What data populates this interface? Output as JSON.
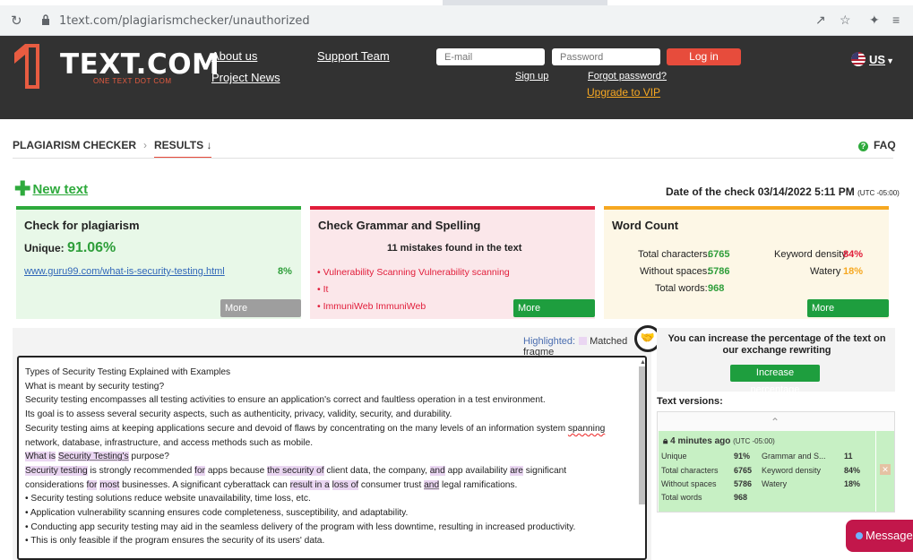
{
  "browser": {
    "url": "1text.com/plagiarismchecker/unauthorized",
    "icons": [
      "reload-icon",
      "lock-icon",
      "share-icon",
      "star-icon",
      "extensions-icon",
      "reading-list-icon"
    ]
  },
  "header": {
    "logo_text": "TEXT.COM",
    "logo_sub": "ONE TEXT DOT COM",
    "nav": {
      "about": "About us",
      "news": "Project News",
      "support": "Support Team"
    },
    "email_placeholder": "E-mail",
    "password_placeholder": "Password",
    "login_label": "Log in",
    "signup_label": "Sign up",
    "forgot_label": "Forgot password?",
    "vip_label": "Upgrade to VIP",
    "lang_label": "US"
  },
  "breadcrumbs": {
    "root": "PLAGIARISM CHECKER",
    "current": "RESULTS",
    "current_arrow": "↓",
    "faq": "FAQ"
  },
  "new_text_label": "New text",
  "date_check": {
    "label": "Date of the check 03/14/2022 5:11 PM",
    "tz": "(UTC -05:00)"
  },
  "cards": {
    "plagiarism": {
      "title": "Check for plagiarism",
      "unique_label": "Unique:",
      "unique_value": "91.06%",
      "source_url": "www.guru99.com/what-is-security-testing.html",
      "source_percent": "8%",
      "more": "More information"
    },
    "grammar": {
      "title": "Check Grammar and Spelling",
      "summary": "11 mistakes found in the text",
      "items": [
        "• Vulnerability Scanning Vulnerability scanning",
        "• It",
        "• ImmuniWeb ImmuniWeb"
      ],
      "more": "More information"
    },
    "wordcount": {
      "title": "Word Count",
      "total_chars_label": "Total characters:",
      "total_chars": "6765",
      "without_spaces_label": "Without spaces:",
      "without_spaces": "5786",
      "total_words_label": "Total words:",
      "total_words": "968",
      "keyword_density_label": "Keyword density",
      "keyword_density": "84%",
      "watery_label": "Watery",
      "watery": "18%",
      "more": "More information"
    }
  },
  "editor": {
    "highlighted_label": "Highlighted:",
    "matched_label": "Matched fragme",
    "lines": {
      "l1": "Types of Security Testing Explained with Examples",
      "l2": "What is meant by security testing?",
      "l3": "Security testing encompasses all testing activities to ensure an application's correct and faultless operation in a test environment.",
      "l4": "Its goal is to assess several security aspects, such as authenticity, privacy, validity, security, and durability.",
      "l5a": "Security testing aims at keeping applications secure and devoid of flaws by concentrating on the many levels of an information system ",
      "l5b": "spanning",
      "l5c": " network, database, infrastructure, and access methods such as mobile.",
      "l6a": "What is",
      "l6b": "Security Testing's",
      "l6c": "purpose?",
      "l7a": "Security testing",
      "l7b": " is strongly recommended ",
      "l7c": "for",
      "l7d": " apps because ",
      "l7e": "the security of",
      "l7f": " client data, the company, ",
      "l7g": "and",
      "l7h": " app availability ",
      "l7i": "are",
      "l7j": " significant considerations ",
      "l7k": "for",
      "l7l": "most",
      "l7m": " businesses. A significant cyberattack can ",
      "l7n": "result in a",
      "l7o": "loss of",
      "l7p": " consumer trust ",
      "l7q": "and",
      "l7r": " legal ramifications.",
      "b1": "• Security testing solutions reduce website unavailability, time loss, etc.",
      "b2": "• Application vulnerability scanning ensures code completeness, susceptibility, and adaptability.",
      "b3": "• Conducting app security testing may aid in the seamless delivery of the program with less downtime, resulting in increased productivity.",
      "b4": "• This is only feasible if the program ensures the security of its users' data."
    }
  },
  "rewrite": {
    "text": "You can increase the percentage of the text on our exchange rewriting",
    "button": "Increase percentage"
  },
  "versions": {
    "label": "Text versions:",
    "entry": {
      "time": "4 minutes ago",
      "tz": "(UTC -05:00)",
      "unique_label": "Unique",
      "unique": "91%",
      "grammar_label": "Grammar and S...",
      "grammar": "11",
      "chars_label": "Total characters",
      "chars": "6765",
      "keyword_label": "Keyword density",
      "keyword": "84%",
      "nospace_label": "Without spaces",
      "nospace": "5786",
      "watery_label": "Watery",
      "watery": "18%",
      "words_label": "Total words",
      "words": "968"
    }
  },
  "message_label": "Message",
  "colors": {
    "header_bg": "#323232",
    "accent_red": "#e74c3c",
    "green": "#2eaa3c",
    "orange": "#f6a821",
    "highlight": "#ead6f2"
  }
}
